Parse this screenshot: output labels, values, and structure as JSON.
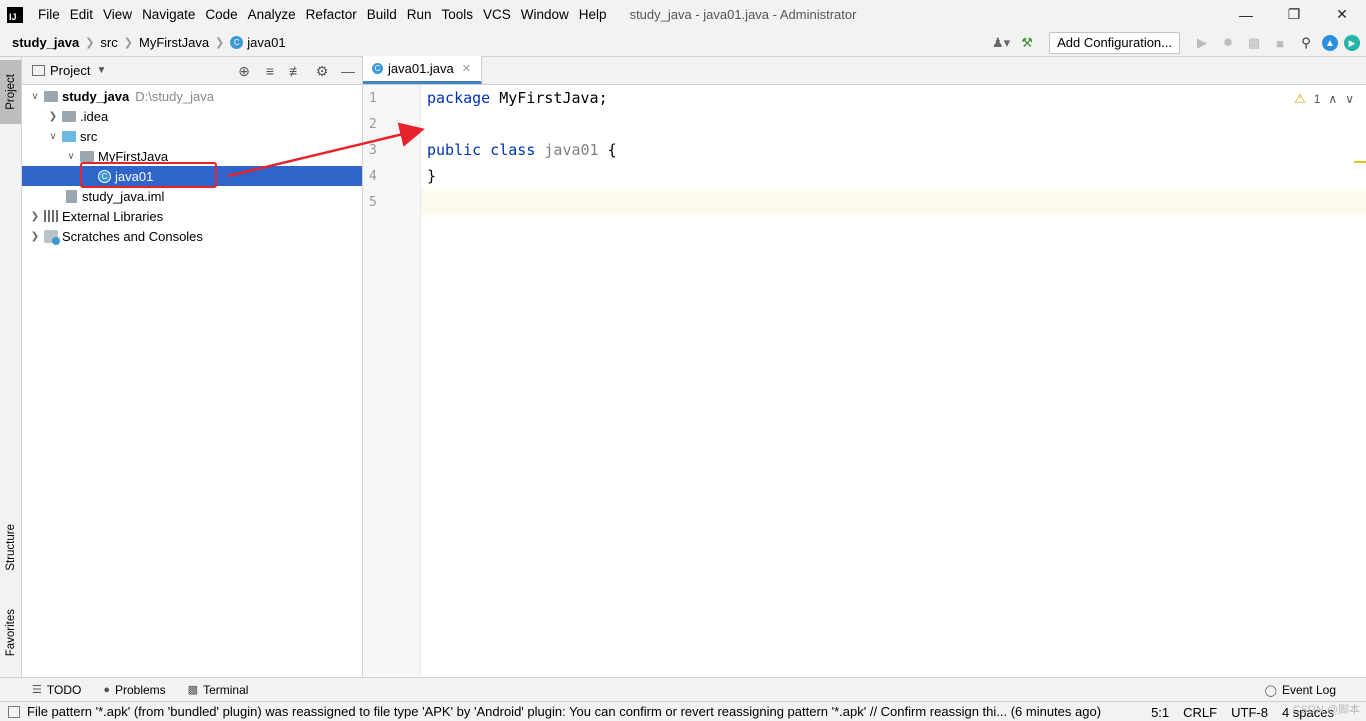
{
  "app": {
    "logo_text": "IJ",
    "window_title": "study_java - java01.java - Administrator"
  },
  "menu": {
    "items": [
      "File",
      "Edit",
      "View",
      "Navigate",
      "Code",
      "Analyze",
      "Refactor",
      "Build",
      "Run",
      "Tools",
      "VCS",
      "Window",
      "Help"
    ]
  },
  "breadcrumb": {
    "project": "study_java",
    "items": [
      "src",
      "MyFirstJava",
      "java01"
    ]
  },
  "toolbar": {
    "add_configuration": "Add Configuration..."
  },
  "left_stripe": {
    "project": "Project",
    "structure": "Structure",
    "favorites": "Favorites"
  },
  "project_panel": {
    "title": "Project",
    "tree": {
      "root_name": "study_java",
      "root_path": "D:\\study_java",
      "idea": ".idea",
      "src": "src",
      "package": "MyFirstJava",
      "class_file": "java01",
      "iml": "study_java.iml",
      "external_libraries": "External Libraries",
      "scratches": "Scratches and Consoles"
    }
  },
  "editor": {
    "tab_label": "java01.java",
    "line_numbers": [
      "1",
      "2",
      "3",
      "4",
      "5"
    ],
    "code": {
      "line1_kw": "package",
      "line1_rest": " MyFirstJava;",
      "line3_kw": "public class",
      "line3_cls": " java01",
      "line3_rest": " {",
      "line4": "}"
    },
    "inspection_count": "1"
  },
  "bottom_tools": {
    "todo": "TODO",
    "problems": "Problems",
    "terminal": "Terminal",
    "event_log": "Event Log"
  },
  "status": {
    "message": "File pattern '*.apk' (from 'bundled' plugin) was reassigned to file type 'APK' by 'Android' plugin: You can confirm or revert reassigning pattern '*.apk' // Confirm reassign thi... (6 minutes ago)",
    "position": "5:1",
    "line_separator": "CRLF",
    "encoding": "UTF-8",
    "indent": "4 spaces",
    "watermark": "CSDN @脚本"
  },
  "colors": {
    "selection": "#2f65ca",
    "keyword": "#0033b3",
    "annotation_red": "#e8222b"
  }
}
